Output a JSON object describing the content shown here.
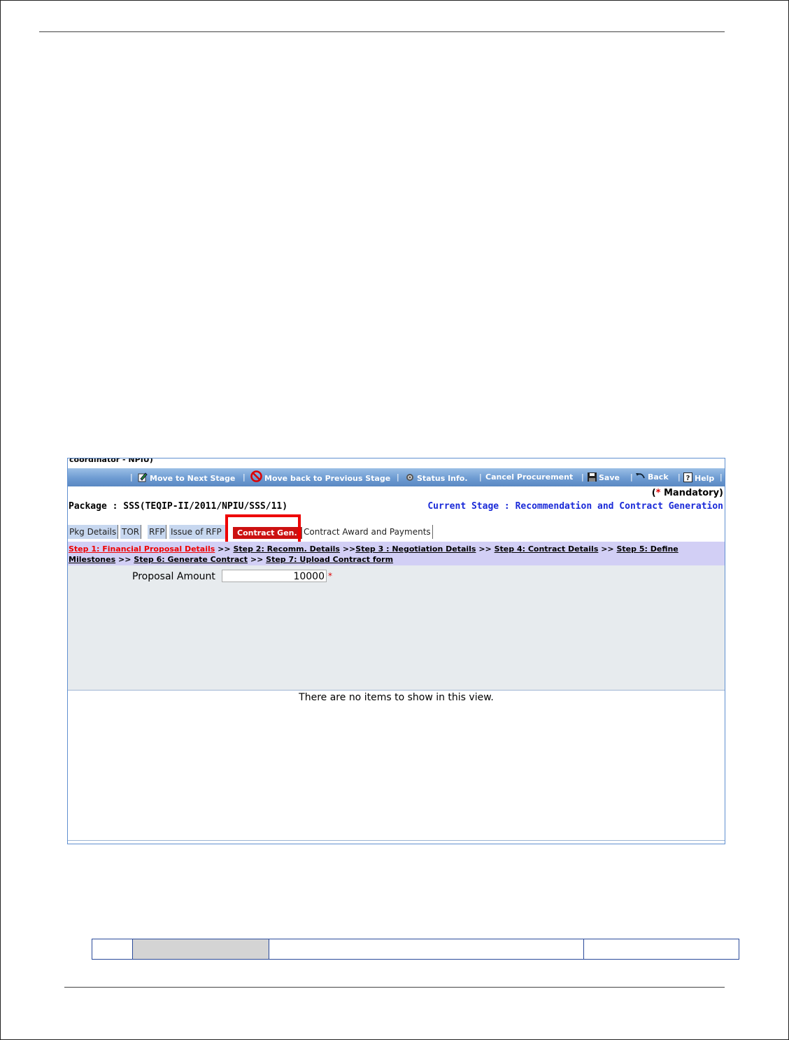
{
  "screenshot": {
    "user_role_partial": "coordinator - NPIU)",
    "toolbar": {
      "move_next": "Move to Next Stage",
      "move_back": "Move back to Previous Stage",
      "status_info": "Status Info.",
      "cancel_procurement": "Cancel Procurement",
      "save": "Save",
      "back": "Back",
      "help": "Help",
      "separator": "|"
    },
    "mandatory": {
      "open": "(",
      "star": "*",
      "label": " Mandatory)"
    },
    "package": "Package : SSS(TEQIP-II/2011/NPIU/SSS/11)",
    "current_stage": "Current Stage : Recommendation and Contract Generation",
    "tabs": [
      "Pkg Details",
      "TOR",
      "RFP",
      "Issue of RFP",
      "Contract Gen.",
      "Contract Award and Payments"
    ],
    "steps": {
      "step1": "Step 1: Financial Proposal Details",
      "step2": "Step 2: Recomm. Details",
      "step3": "Step 3 : Negotiation Details",
      "step4": "Step 4: Contract Details",
      "step5a": "Step 5: Define",
      "step5b": "Milestones",
      "step6": "Step 6: Generate Contract",
      "step7": "Step 7: Upload Contract form",
      "sep": ">>"
    },
    "proposal_label": "Proposal Amount",
    "proposal_value": "10000",
    "required_star": "*",
    "empty_message": "There are no items to show in this view."
  },
  "colors": {
    "toolbar": "#6d9bd2",
    "active_tab": "#cc1111",
    "highlight_box": "#ee0000",
    "steps_bg": "#d2cff5",
    "current_stage_text": "#1a2ad8"
  }
}
